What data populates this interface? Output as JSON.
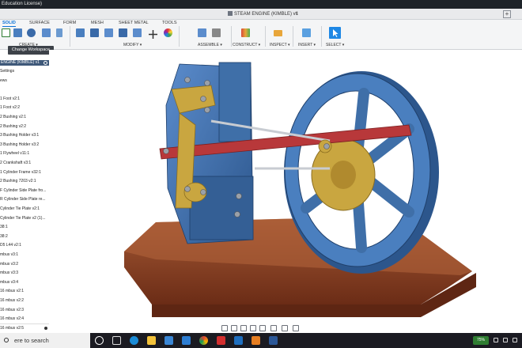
{
  "window": {
    "title": "Education License)"
  },
  "document": {
    "tab_title": "STEAM ENGINE (KIMBLE) v1",
    "close_symbol": "×",
    "new_tab_symbol": "+"
  },
  "ribbon": {
    "tabs": [
      "SOLID",
      "SURFACE",
      "FORM",
      "MESH",
      "SHEET METAL",
      "TOOLS"
    ],
    "active_tab": "SOLID",
    "groups": [
      "CREATE ▾",
      "MODIFY ▾",
      "ASSEMBLE ▾",
      "CONSTRUCT ▾",
      "INSPECT ▾",
      "INSERT ▾",
      "SELECT ▾"
    ],
    "accent_color": "#0b73d8"
  },
  "tooltip": {
    "text": "Change Workspace"
  },
  "browser": {
    "header": "ENGINE (KIMBLE) v1",
    "items": [
      "Settings",
      "ews",
      "",
      "1 Foot v2:1",
      "1 Foot v2:2",
      "2 Bushing v2:1",
      "2 Bushing v2:2",
      "3 Bushing Holder v3:1",
      "3 Bushing Holder v3:2",
      "1 Flywheel v11:1",
      "2 Crankshaft v3:1",
      "1 Cylinder Frame v32:1",
      "2 Bushing 7203 v2:1",
      "F Cylinder Side Plate fro...",
      "R Cylinder Side Plate re...",
      "Cylinder Tie Plate v2:1",
      "Cylinder Tie Plate v2 (1)...",
      "38:1",
      "38:2",
      "D5 L44 v2:1",
      "mbus v3:1",
      "mbus v3:2",
      "mbus v3:3",
      "mbus v3:4",
      "16 mbus v2:1",
      "16 mbus v2:2",
      "16 mbus v2:3",
      "16 mbus v2:4",
      "16 mbus v2:5"
    ]
  },
  "model": {
    "body_color": "#3f6fa8",
    "brass_color": "#c9a640",
    "rod_color": "#b8383a",
    "base_color": "#8a3d22"
  },
  "taskbar": {
    "search_placeholder": "ere to search",
    "apps": [
      "task-view-icon",
      "edge-icon",
      "explorer-icon",
      "store-icon",
      "mail-icon",
      "chrome-icon",
      "acrobat-icon",
      "photos-icon",
      "fusion-icon",
      "word-icon"
    ],
    "tray_badge": "75%"
  }
}
